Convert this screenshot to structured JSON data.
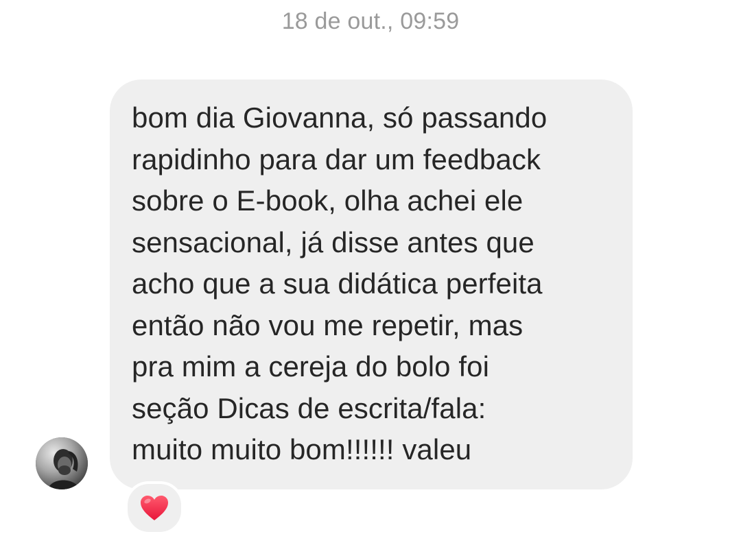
{
  "conversation": {
    "timestamp": "18 de out., 09:59",
    "message": {
      "text": "bom dia Giovanna, só passando\nrapidinho para dar um feedback\nsobre o E-book, olha achei ele\nsensacional, já disse antes que\nacho que a sua didática perfeita\nentão não vou me repetir, mas\npra mim a cereja do bolo foi\nseção Dicas de escrita/fala:\nmuito muito bom!!!!!! valeu",
      "sender_avatar_icon": "avatar-photo",
      "reaction_icon": "heart-icon"
    }
  },
  "colors": {
    "bubble_background": "#efefef",
    "timestamp_text": "#9a9a9a",
    "message_text": "#262626",
    "heart": "#ff3040"
  }
}
